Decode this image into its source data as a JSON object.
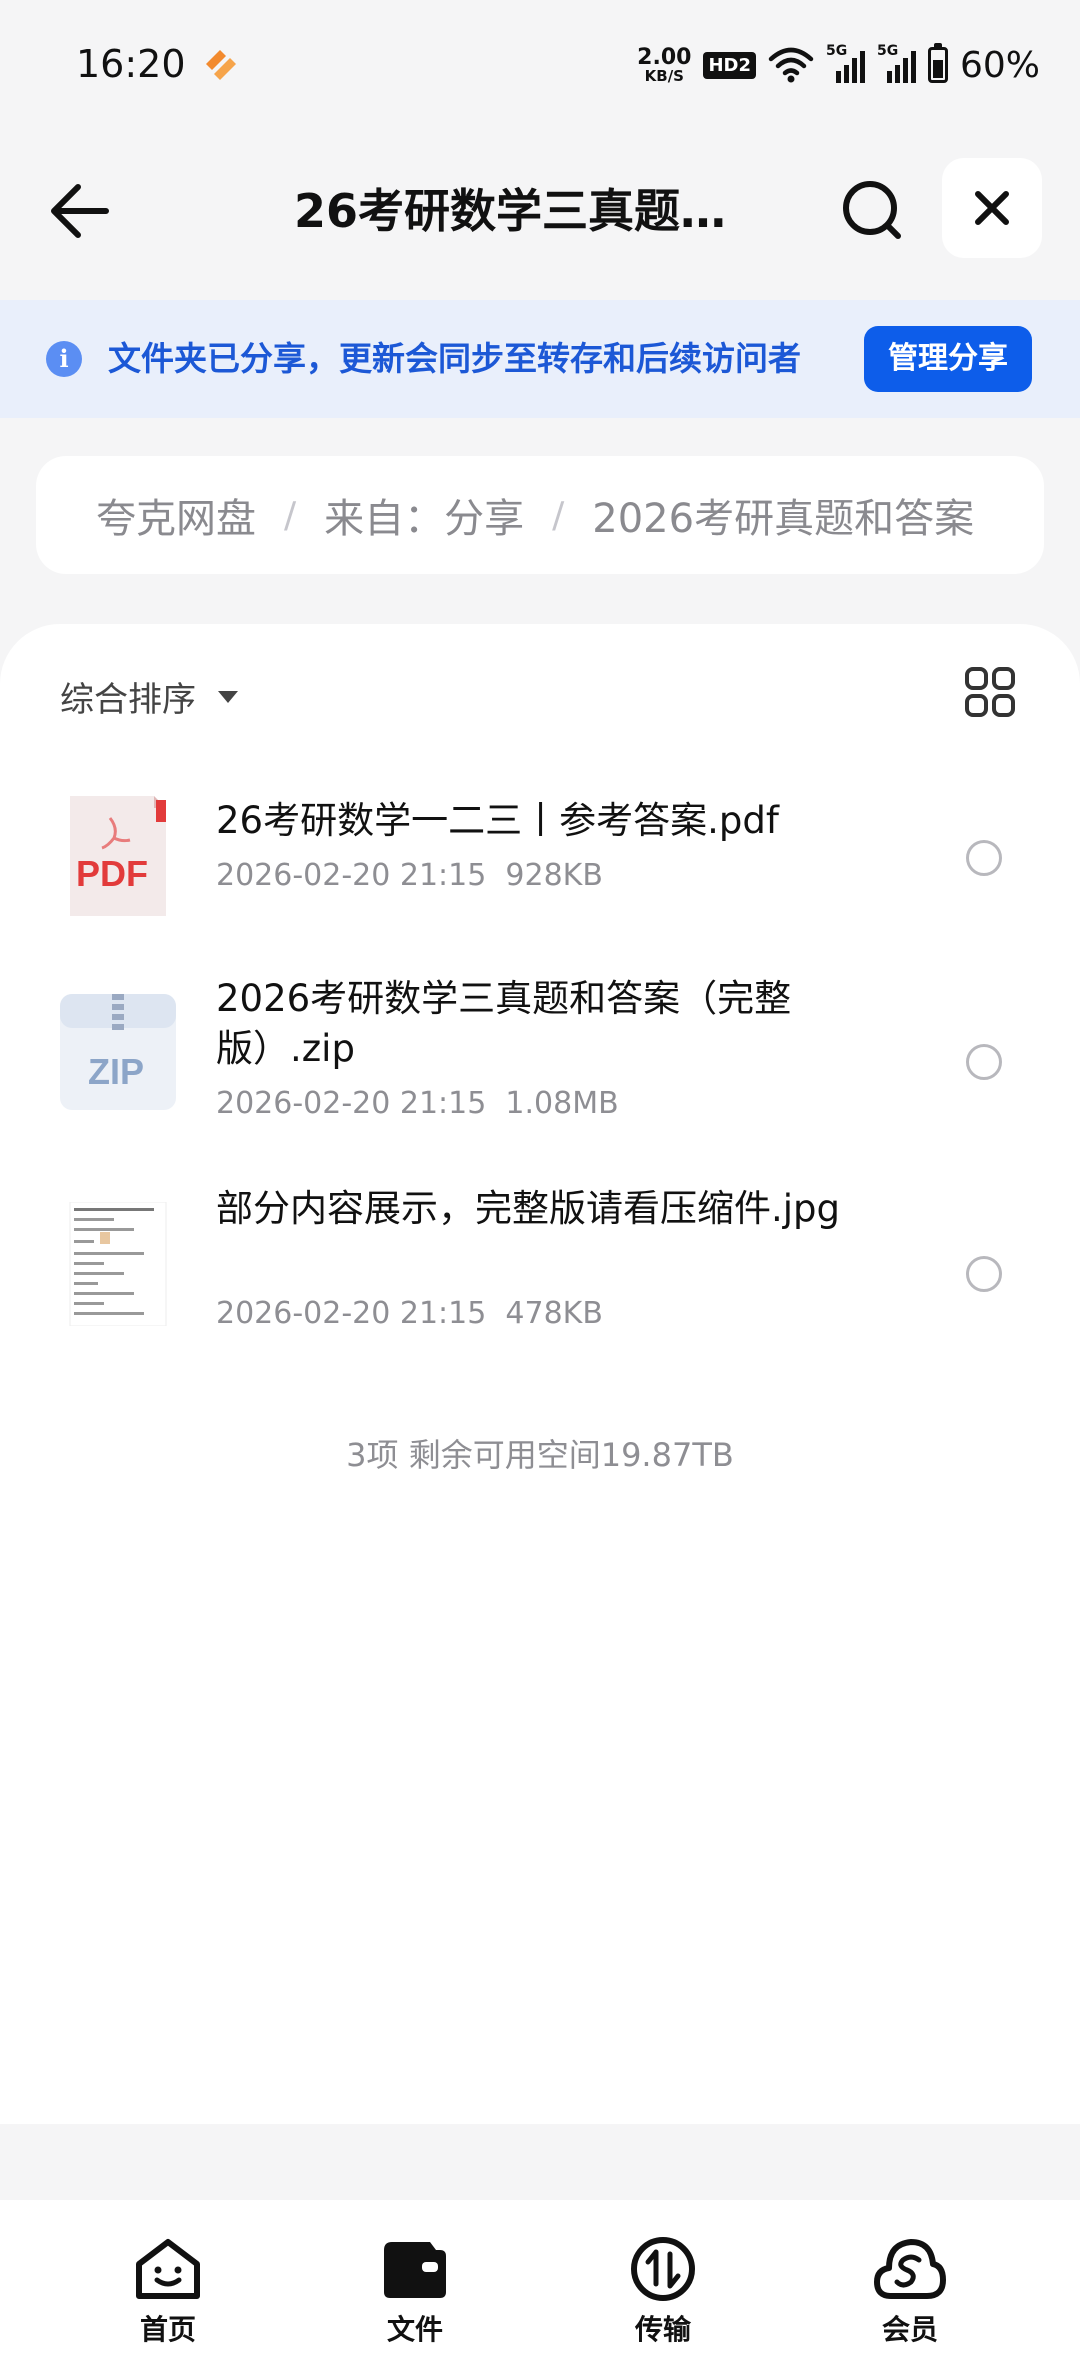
{
  "status_bar": {
    "time": "16:20",
    "net_speed_value": "2.00",
    "net_speed_unit": "KB/S",
    "hd_badge": "HD2",
    "sim1_label": "5G",
    "sim2_label": "5G",
    "battery_percent": "60%",
    "battery_level": 0.6
  },
  "header": {
    "title": "26考研数学三真题…",
    "back_icon": "arrow-left-icon",
    "search_icon": "search-icon",
    "close_icon": "close-icon"
  },
  "share_banner": {
    "icon": "info-icon",
    "icon_glyph": "i",
    "message": "文件夹已分享，更新会同步至转存和后续访问者",
    "action_label": "管理分享"
  },
  "breadcrumb": {
    "items": [
      "夸克网盘",
      "来自：分享",
      "2026考研真题和答案"
    ],
    "separator": "/"
  },
  "toolbar": {
    "sort_label": "综合排序",
    "view_toggle_icon": "grid-view-icon"
  },
  "files": [
    {
      "name": "26考研数学一二三丨参考答案.pdf",
      "date": "2026-02-20 21:15",
      "size": "928KB",
      "type": "pdf",
      "thumb_label": "PDF"
    },
    {
      "name": "2026考研数学三真题和答案（完整版）.zip",
      "date": "2026-02-20 21:15",
      "size": "1.08MB",
      "type": "zip",
      "thumb_label": "ZIP"
    },
    {
      "name": "部分内容展示，完整版请看压缩件.jpg",
      "date": "2026-02-20 21:15",
      "size": "478KB",
      "type": "jpg",
      "thumb_label": ""
    }
  ],
  "footer": {
    "summary": "3项 剩余可用空间19.87TB"
  },
  "tabs": [
    {
      "label": "首页",
      "icon": "home-face-icon"
    },
    {
      "label": "文件",
      "icon": "folder-icon"
    },
    {
      "label": "传输",
      "icon": "transfer-icon"
    },
    {
      "label": "会员",
      "icon": "membership-cloud-icon"
    }
  ],
  "colors": {
    "accent": "#0d5dea",
    "banner_bg": "#e9effb",
    "banner_text": "#1c58d6",
    "pdf_red": "#e23b3b",
    "zip_blue": "#8ca5c8"
  }
}
